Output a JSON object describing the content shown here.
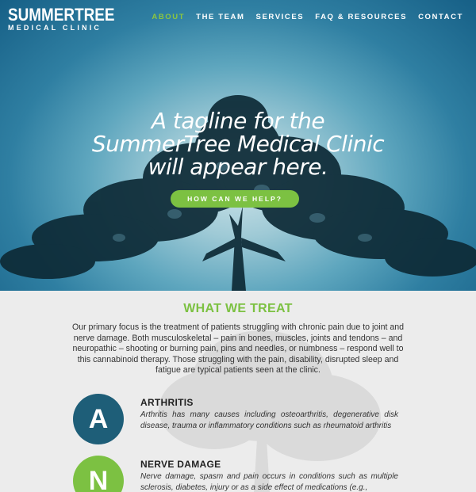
{
  "logo": {
    "main": "SUMMERTREE",
    "sub": "MEDICAL CLINIC"
  },
  "nav": {
    "items": [
      {
        "label": "ABOUT",
        "active": true
      },
      {
        "label": "THE TEAM",
        "active": false
      },
      {
        "label": "SERVICES",
        "active": false
      },
      {
        "label": "FAQ & RESOURCES",
        "active": false
      },
      {
        "label": "CONTACT",
        "active": false
      }
    ]
  },
  "hero": {
    "tagline_lines": [
      "A tagline for the",
      "SummerTree Medical Clinic",
      "will appear here."
    ],
    "cta_label": "HOW CAN WE HELP?"
  },
  "treat": {
    "heading": "WHAT WE TREAT",
    "intro": "Our primary focus  is the treatment of patients struggling with chronic pain due to joint and nerve damage. Both musculoskeletal – pain in bones, muscles, joints and tendons – and neuropathic – shooting or burning pain, pins and needles, or numbness – respond well to this cannabinoid therapy.  Those struggling with the pain, disability, disrupted sleep and fatigue are typical patients seen at the clinic.",
    "items": [
      {
        "letter": "A",
        "title": "ARTHRITIS",
        "description": "Arthritis has many causes including osteoarthritis, degenerative disk disease, trauma or inflammatory conditions such as rheumatoid arthritis",
        "color": "#1e5e78"
      },
      {
        "letter": "N",
        "title": "NERVE DAMAGE",
        "description": "Nerve damage, spasm and pain occurs in conditions such as multiple sclerosis, diabetes, injury or as a side effect of medications (e.g.,",
        "color": "#7cc142"
      }
    ]
  },
  "colors": {
    "accent_green": "#7cc142",
    "dark_teal": "#1e5e78",
    "hero_blue": "#2f7fa2"
  }
}
